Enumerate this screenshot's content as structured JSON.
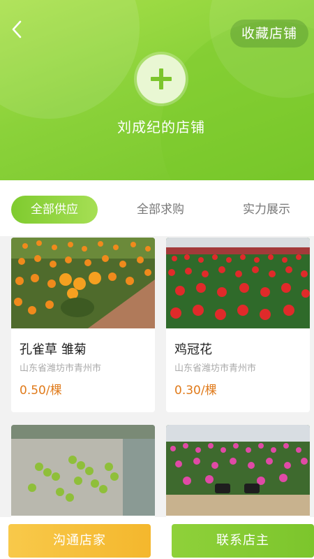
{
  "header": {
    "back_icon": "chevron-left-icon",
    "favorite_label": "收藏店铺",
    "avatar_icon": "plus-icon",
    "shop_name": "刘成纪的店铺"
  },
  "tabs": [
    {
      "label": "全部供应",
      "active": true
    },
    {
      "label": "全部求购",
      "active": false
    },
    {
      "label": "实力展示",
      "active": false
    }
  ],
  "products": [
    {
      "title": "孔雀草 雏菊",
      "location": "山东省潍坊市青州市",
      "price": "0.50/棵"
    },
    {
      "title": "鸡冠花",
      "location": "山东省潍坊市青州市",
      "price": "0.30/棵"
    },
    {
      "title": "",
      "location": "",
      "price": ""
    },
    {
      "title": "",
      "location": "",
      "price": ""
    }
  ],
  "bottom": {
    "talk_label": "沟通店家",
    "contact_label": "联系店主"
  },
  "colors": {
    "brand_green": "#8bd23a",
    "price_orange": "#e07a1a",
    "talk_yellow": "#f4b72d"
  }
}
